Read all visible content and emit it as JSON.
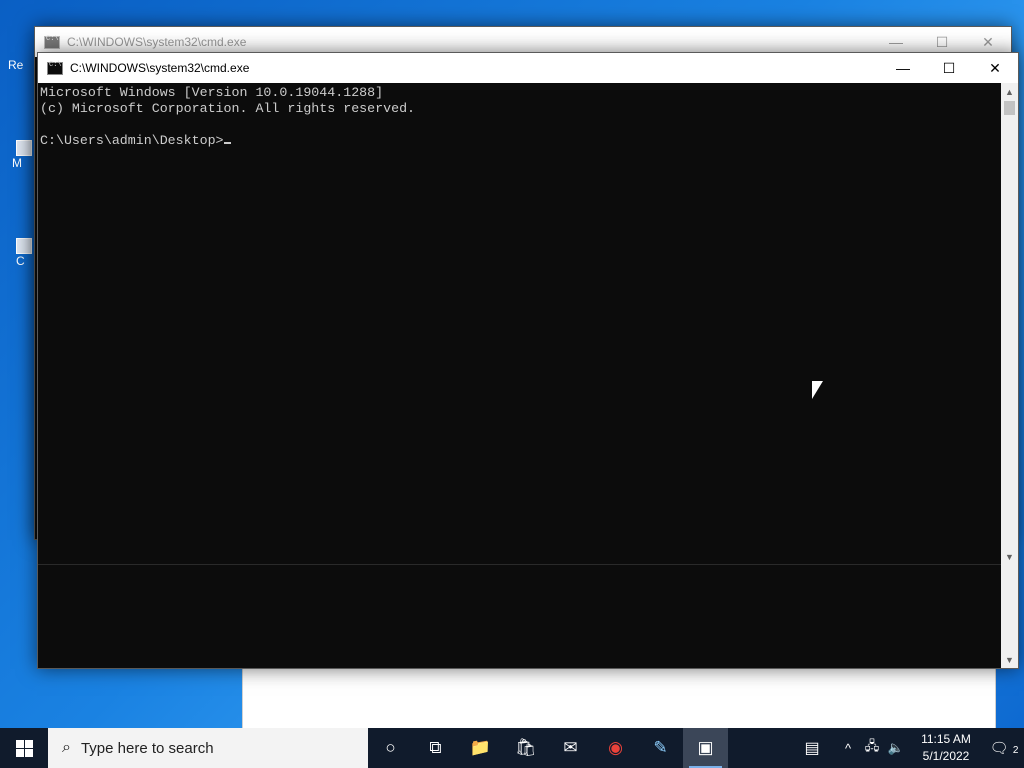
{
  "desktop": {
    "partial_labels": [
      "Re",
      "M",
      "C"
    ]
  },
  "bg_cmd": {
    "title": "C:\\WINDOWS\\system32\\cmd.exe",
    "minimize": "—",
    "maximize": "☐",
    "close": "✕"
  },
  "cmd": {
    "title": "C:\\WINDOWS\\system32\\cmd.exe",
    "minimize": "—",
    "maximize": "☐",
    "close": "✕",
    "lines": [
      "Microsoft Windows [Version 10.0.19044.1288]",
      "(c) Microsoft Corporation. All rights reserved.",
      "",
      "C:\\Users\\admin\\Desktop>"
    ]
  },
  "taskbar": {
    "search_placeholder": "Type here to search",
    "apps": [
      {
        "name": "cortana-icon",
        "glyph": "○"
      },
      {
        "name": "task-view-icon",
        "glyph": "⧉"
      },
      {
        "name": "file-explorer-icon",
        "glyph": "📁"
      },
      {
        "name": "store-icon",
        "glyph": "🛍"
      },
      {
        "name": "mail-icon",
        "glyph": "✉"
      },
      {
        "name": "chrome-icon",
        "glyph": "◉"
      },
      {
        "name": "notepad-icon",
        "glyph": "✎"
      },
      {
        "name": "cmd-icon",
        "glyph": "▣"
      }
    ],
    "tray": {
      "news": "▤",
      "chevron": "^",
      "network": "🖧",
      "volume": "🔈",
      "time": "11:15 AM",
      "date": "5/1/2022",
      "notification_count": "2"
    }
  },
  "colors": {
    "console_bg": "#0c0c0c",
    "console_text": "#cccccc",
    "taskbar_bg": "#101b2c",
    "desktop_blue": "#1a82e2"
  }
}
